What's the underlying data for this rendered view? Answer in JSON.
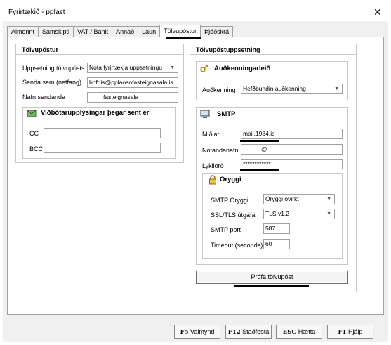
{
  "window": {
    "title": "Fyrirtækið - ppfast",
    "close_label": "✕"
  },
  "tabs": [
    {
      "label": "Almennt"
    },
    {
      "label": "Samskipti"
    },
    {
      "label": "VAT / Bank"
    },
    {
      "label": "Annað"
    },
    {
      "label": "Laun"
    },
    {
      "label": "Tölvupóstur",
      "active": true
    },
    {
      "label": "Þjóðskrá"
    }
  ],
  "email_panel": {
    "title": "Tölvupóstur",
    "setup_label": "Uppsetning tölvupósts",
    "setup_value": "Nota fyrirtækja uppsetningu",
    "send_as_label": "Senda sem (netfang)",
    "send_as_value": "bofdis@pplaosofasteignasala.is",
    "sender_name_label": "Nafn sendanda",
    "sender_name_value": "fasteignasala",
    "extra_title": "Viðbótarupplýsingar þegar sent er",
    "cc_label": "CC",
    "cc_value": "",
    "bcc_label": "BCC",
    "bcc_value": ""
  },
  "email_setup": {
    "title": "Tölvupóstuppsetning",
    "auth_title": "Auðkenningarleið",
    "auth_label": "Auðkenning",
    "auth_value": "Hefðbundin auðkenning",
    "smtp_title": "SMTP",
    "server_label": "Miðlari",
    "server_value": "mail.1984.is",
    "username_label": "Notandanafn",
    "username_value": "@",
    "password_label": "Lykilorð",
    "password_value": "************",
    "security_title": "Öryggi",
    "smtp_security_label": "SMTP Öryggi",
    "smtp_security_value": "Öryggi óvirkt",
    "tls_label": "SSL/TLS útgáfa",
    "tls_value": "TLS v1.2",
    "port_label": "SMTP port",
    "port_value": "587",
    "timeout_label": "Timeout (seconds)",
    "timeout_value": "60",
    "test_button": "Prófa tölvupóst"
  },
  "footer": {
    "f5_key": "F5",
    "f5_label": "Valmynd",
    "f12_key": "F12",
    "f12_label": "Staðfesta",
    "esc_key": "ESC",
    "esc_label": "Hætta",
    "f1_key": "F1",
    "f1_label": "Hjálp"
  },
  "icons": [
    "key-icon",
    "computer-icon",
    "lock-icon",
    "envelope-icon"
  ]
}
